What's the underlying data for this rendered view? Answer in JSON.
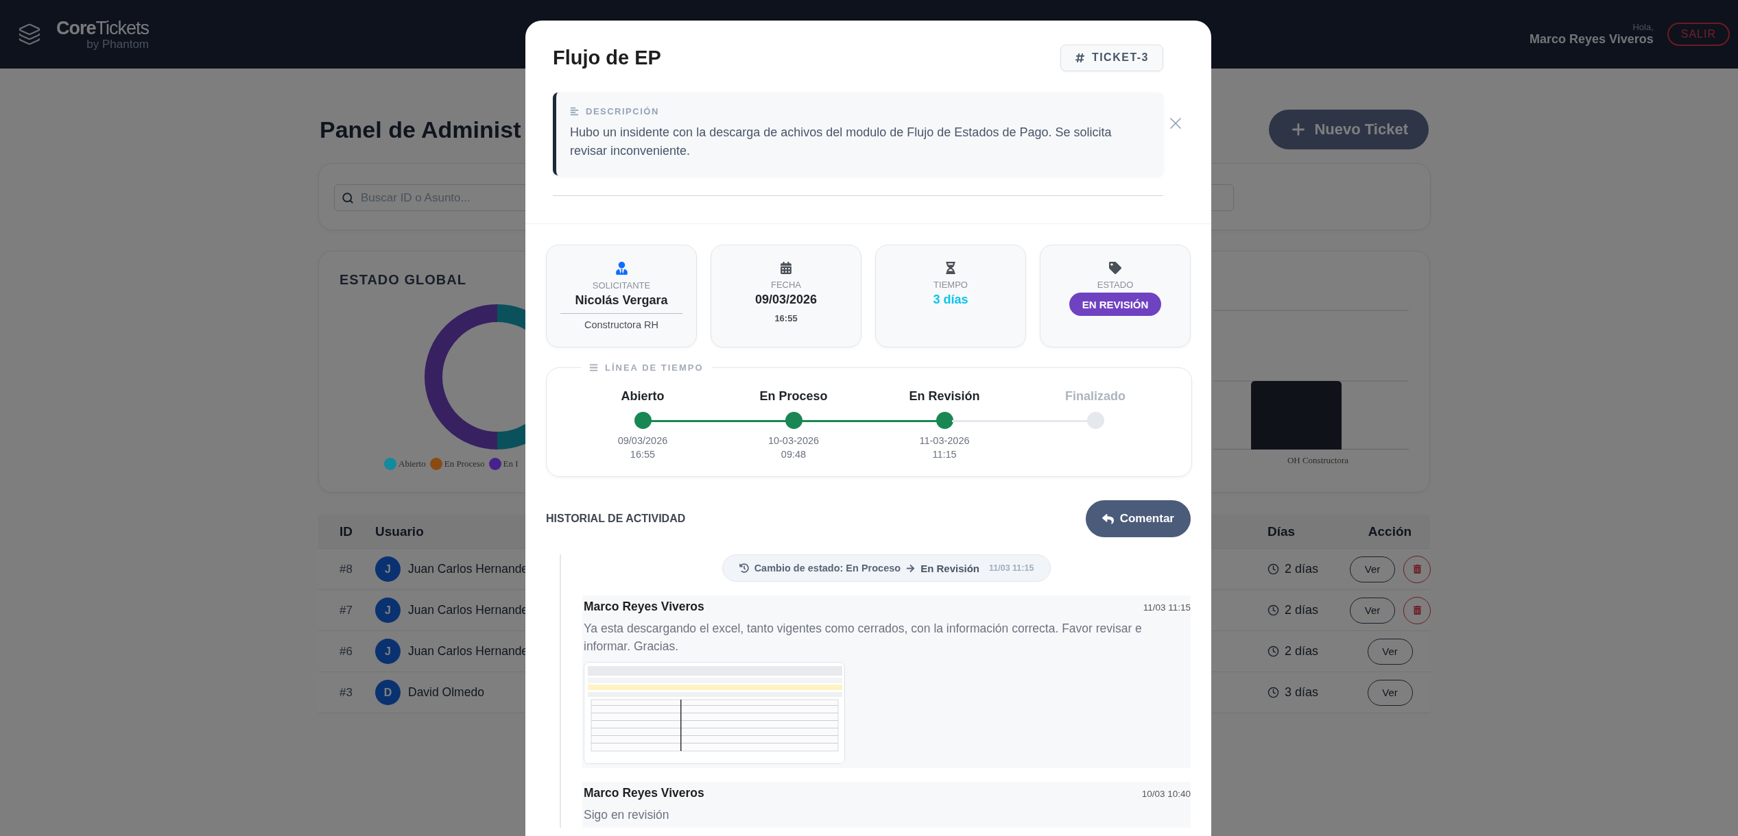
{
  "header": {
    "brand": "**Core**Tickets",
    "brand_sub": "by Phantom",
    "greeting": "Hola,",
    "user": "Marco Reyes Viveros",
    "logout": "SALIR"
  },
  "page": {
    "title": "Panel de Administ",
    "new_button": "Nuevo Ticket",
    "search": {
      "placeholder": "Buscar ID o Asunto..."
    }
  },
  "status_card": {
    "title": "ESTADO GLOBAL",
    "legend": [
      {
        "label": "Abierto",
        "color": "#138a9e"
      },
      {
        "label": "En Proceso",
        "color": "#8c4a12"
      },
      {
        "label": "En I",
        "color": "#46238a"
      }
    ]
  },
  "bar_chart": {
    "category": "OH Constructora"
  },
  "table": {
    "columns": [
      "ID",
      "Usuario",
      "Días",
      "Acción"
    ],
    "rows": [
      {
        "id": "#8",
        "initial": "J",
        "user": "Juan Carlos Hernande",
        "days": "2 días",
        "view": "Ver",
        "deletable": true
      },
      {
        "id": "#7",
        "initial": "J",
        "user": "Juan Carlos Hernande",
        "days": "2 días",
        "view": "Ver",
        "deletable": true
      },
      {
        "id": "#6",
        "initial": "J",
        "user": "Juan Carlos Hernande",
        "days": "2 días",
        "view": "Ver",
        "deletable": false
      },
      {
        "id": "#3",
        "initial": "D",
        "user": "David Olmedo",
        "days": "3 días",
        "view": "Ver",
        "deletable": false
      }
    ]
  },
  "modal": {
    "title": "Flujo de EP",
    "ticket": "TICKET-3",
    "description": {
      "label": "DESCRIPCIÓN",
      "text": "Hubo un insidente con la descarga de achivos del modulo de Flujo de Estados de Pago. Se solicita revisar inconveniente."
    },
    "info": [
      {
        "kind": "person",
        "label": "SOLICITANTE",
        "value": "Nicolás Vergara",
        "sub": "Constructora RH"
      },
      {
        "kind": "date",
        "label": "FECHA",
        "value": "09/03/2026",
        "sub": "16:55"
      },
      {
        "kind": "time",
        "label": "TIEMPO",
        "value": "3 días"
      },
      {
        "kind": "status",
        "label": "ESTADO",
        "badge": "EN REVISIÓN"
      }
    ],
    "timeline": {
      "title": "LÍNEA DE TIEMPO",
      "steps": [
        {
          "label": "Abierto",
          "done": true,
          "date": "09/03/2026",
          "time": "16:55"
        },
        {
          "label": "En Proceso",
          "done": true,
          "date": "10-03-2026",
          "time": "09:48"
        },
        {
          "label": "En Revisión",
          "done": true,
          "date": "11-03-2026",
          "time": "11:15"
        },
        {
          "label": "Finalizado",
          "done": false
        }
      ]
    },
    "history": {
      "title": "HISTORIAL DE ACTIVIDAD",
      "comment_button": "Comentar",
      "entries": [
        {
          "kind": "status_change",
          "text": "Cambio de estado: En Proceso",
          "to": "En Revisión",
          "time": "11/03 11:15"
        },
        {
          "kind": "comment",
          "author": "Marco Reyes Viveros",
          "time": "11/03 11:15",
          "text": "Ya esta descargando el excel, tanto vigentes como cerrados, con la información correcta. Favor revisar e informar. Gracias."
        },
        {
          "kind": "comment",
          "author": "Marco Reyes Viveros",
          "time": "10/03 10:40",
          "text": "Sigo en revisión"
        }
      ]
    }
  }
}
